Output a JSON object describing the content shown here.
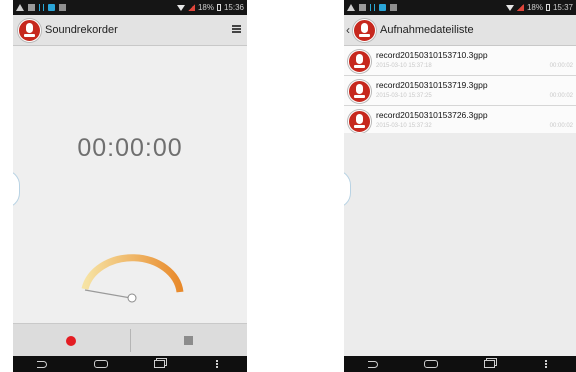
{
  "left_screen": {
    "status": {
      "battery": "18%",
      "time": "15:36"
    },
    "app_title": "Soundrekorder",
    "menu_icon": "menu-icon",
    "timer": "00:00:00",
    "controls": {
      "record_icon": "record-icon",
      "stop_icon": "stop-icon"
    }
  },
  "right_screen": {
    "status": {
      "battery": "18%",
      "time": "15:37"
    },
    "title": "Aufnahmedateiliste",
    "recordings": [
      {
        "name": "record20150310153710.3gpp",
        "date": "2015-03-10 15:37:18",
        "duration": "00:00:02"
      },
      {
        "name": "record20150310153719.3gpp",
        "date": "2015-03-10 15:37:25",
        "duration": "00:00:02"
      },
      {
        "name": "record20150310153726.3gpp",
        "date": "2015-03-10 15:37:32",
        "duration": "00:00:02"
      }
    ]
  },
  "colors": {
    "accent_red": "#c6281e",
    "record_red": "#e41d23",
    "gauge_start": "#f6e3a4",
    "gauge_end": "#e88a2c"
  },
  "gauge_level": 0
}
